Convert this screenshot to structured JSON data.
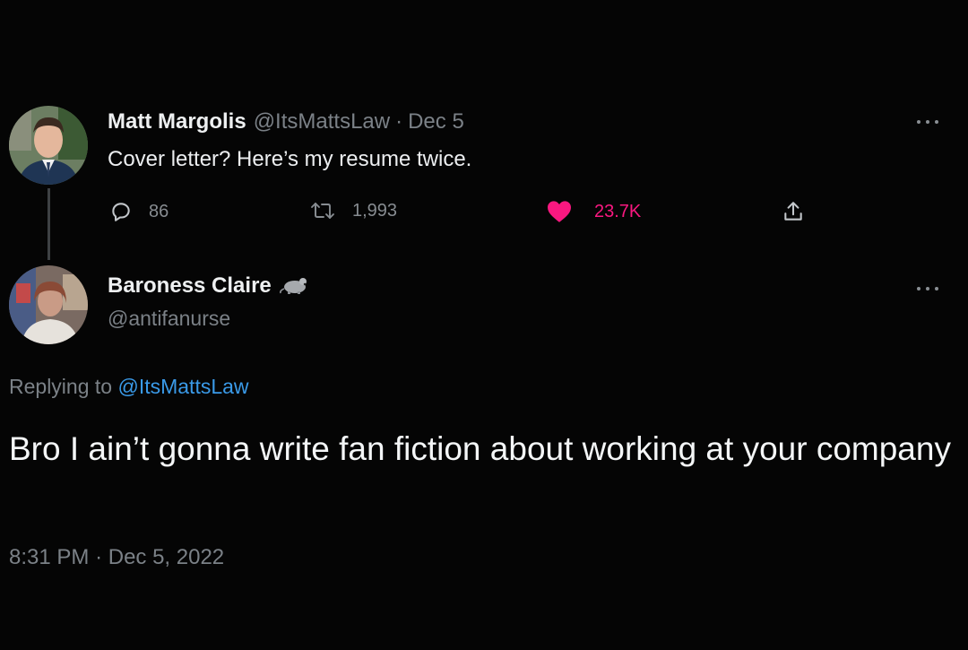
{
  "tweet1": {
    "display_name": "Matt Margolis",
    "handle": "@ItsMattsLaw",
    "separator": "·",
    "date": "Dec 5",
    "text": "Cover letter? Here’s my resume twice.",
    "stats": {
      "replies": "86",
      "retweets": "1,993",
      "likes": "23.7K"
    },
    "icons": [
      "reply-icon",
      "retweet-icon",
      "like-heart-icon",
      "share-icon",
      "more-icon"
    ]
  },
  "tweet2": {
    "display_name": "Baroness Claire",
    "badge": "rat-emoji",
    "handle": "@antifanurse",
    "replying_prefix": "Replying to",
    "replying_mention": "@ItsMattsLaw",
    "text": "Bro I ain’t gonna write fan fiction about working at your company",
    "time": "8:31 PM",
    "separator": "·",
    "date": "Dec 5, 2022"
  },
  "colors": {
    "background": "#050505",
    "text_primary": "#e7e9ea",
    "text_secondary": "#7b8187",
    "like": "#f91880",
    "link": "#3a9ae8"
  }
}
